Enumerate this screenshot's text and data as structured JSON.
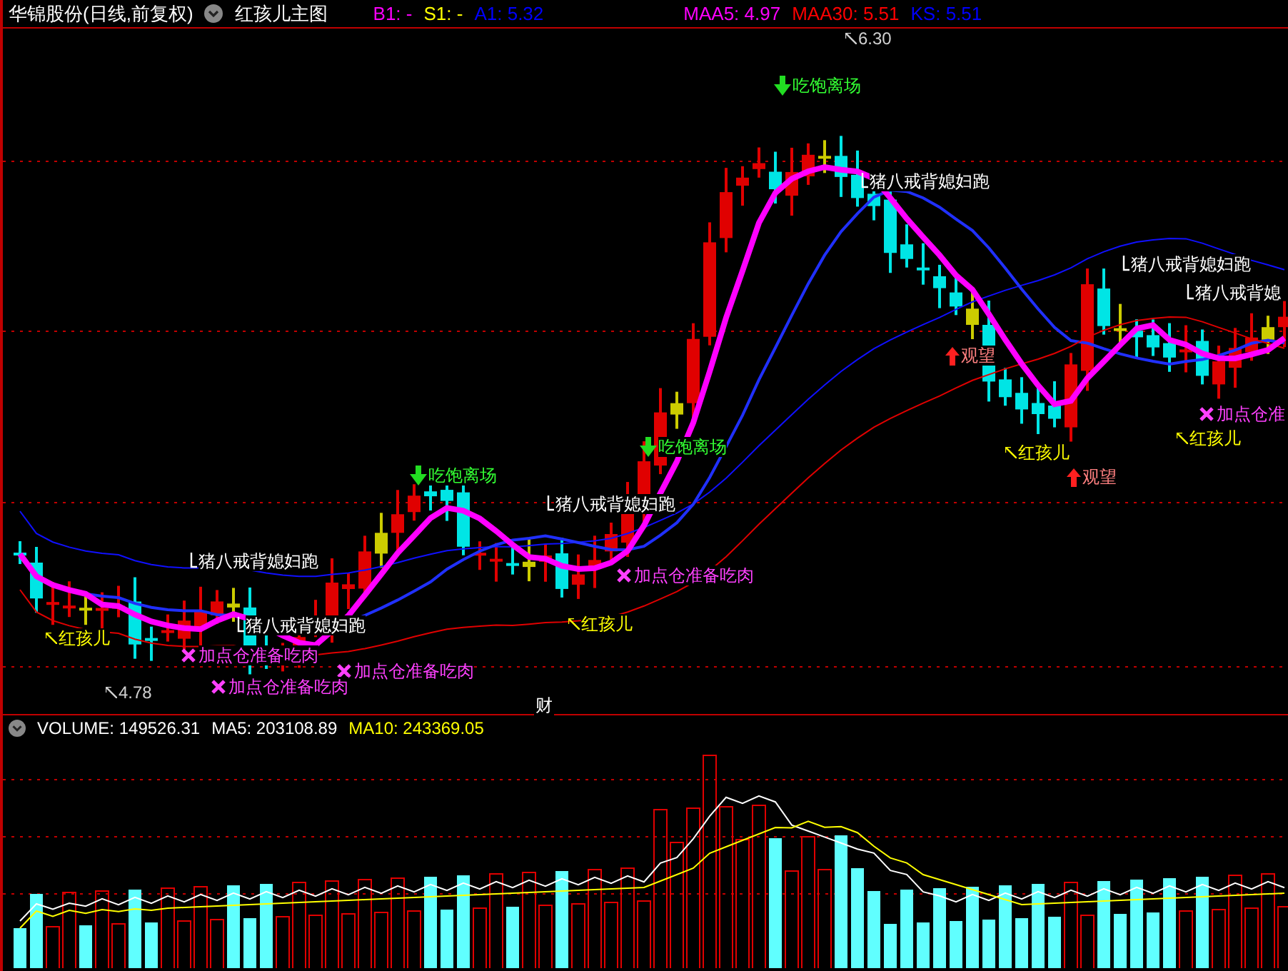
{
  "main_panel": {
    "stock_name": "华锦股份(日线,前复权)",
    "indicator": "红孩儿主图",
    "readouts": [
      {
        "label": "B1: -",
        "color": "#ff00ff"
      },
      {
        "label": "S1: -",
        "color": "#ffff00"
      },
      {
        "label": "A1: 5.32",
        "color": "#0000ff"
      },
      {
        "label": "MAA5: 4.97",
        "color": "#ff00ff"
      },
      {
        "label": "MAA30: 5.51",
        "color": "#ff0000"
      },
      {
        "label": "KS: 5.51",
        "color": "#0000ff"
      }
    ],
    "annotations": [
      {
        "kind": "price",
        "text": "6.30"
      },
      {
        "kind": "exit",
        "text": "吃饱离场"
      },
      {
        "kind": "sell",
        "text": "猪八戒背媳妇跑"
      },
      {
        "kind": "sell",
        "text": "猪八戒背媳妇跑"
      },
      {
        "kind": "sell",
        "text": "猪八戒背媳"
      },
      {
        "kind": "watch",
        "text": "观望"
      },
      {
        "kind": "add",
        "text": "加点仓准"
      },
      {
        "kind": "buy",
        "text": "红孩儿"
      },
      {
        "kind": "exit",
        "text": "吃饱离场"
      },
      {
        "kind": "buy",
        "text": "红孩儿"
      },
      {
        "kind": "exit",
        "text": "吃饱离场"
      },
      {
        "kind": "watch",
        "text": "观望"
      },
      {
        "kind": "sell",
        "text": "猪八戒背媳妇跑"
      },
      {
        "kind": "sell",
        "text": "猪八戒背媳妇跑"
      },
      {
        "kind": "add",
        "text": "加点仓准备吃肉"
      },
      {
        "kind": "buy",
        "text": "红孩儿"
      },
      {
        "kind": "sell",
        "text": "猪八戒背媳妇跑"
      },
      {
        "kind": "buy",
        "text": "红孩儿"
      },
      {
        "kind": "add",
        "text": "加点仓准备吃肉"
      },
      {
        "kind": "add",
        "text": "加点仓准备吃肉"
      },
      {
        "kind": "price",
        "text": "4.78"
      },
      {
        "kind": "add",
        "text": "加点仓准备吃肉"
      },
      {
        "kind": "marker",
        "text": "财"
      }
    ]
  },
  "volume_panel": {
    "readouts": [
      {
        "label": "VOLUME: 149526.31",
        "color": "#ffffff"
      },
      {
        "label": "MA5: 203108.89",
        "color": "#ffffff"
      },
      {
        "label": "MA10: 243369.05",
        "color": "#ffff00"
      }
    ]
  }
}
